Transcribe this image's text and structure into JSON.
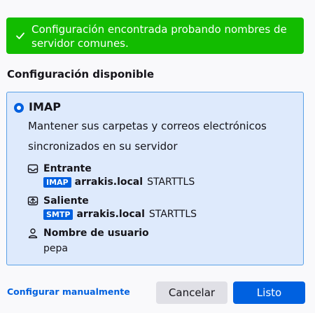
{
  "banner": {
    "message": "Configuración encontrada probando nombres de servidor comunes."
  },
  "section_title": "Configuración disponible",
  "option": {
    "protocol": "IMAP",
    "description": "Mantener sus carpetas y correos electrónicos sincronizados en su servidor",
    "incoming": {
      "label": "Entrante",
      "badge": "IMAP",
      "host": "arrakis.local",
      "security": "STARTTLS"
    },
    "outgoing": {
      "label": "Saliente",
      "badge": "SMTP",
      "host": "arrakis.local",
      "security": "STARTTLS"
    },
    "username": {
      "label": "Nombre de usuario",
      "value": "pepa"
    }
  },
  "footer": {
    "manual_link": "Configurar manualmente",
    "cancel_label": "Cancelar",
    "done_label": "Listo"
  },
  "colors": {
    "success": "#12bc00",
    "accent": "#0060df",
    "card_bg": "#deeafc",
    "card_border": "#5aa0e6"
  }
}
